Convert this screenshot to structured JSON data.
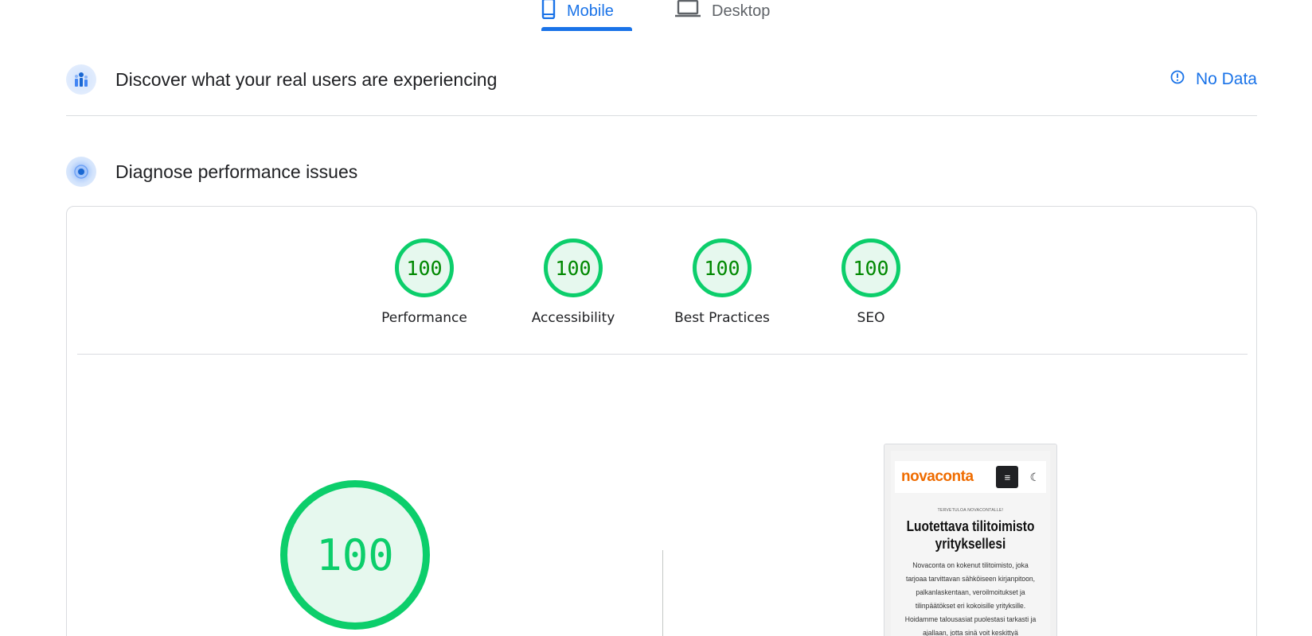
{
  "tabs": [
    {
      "label": "Mobile",
      "active": true,
      "icon": "smartphone-icon"
    },
    {
      "label": "Desktop",
      "active": false,
      "icon": "laptop-icon"
    }
  ],
  "field_data": {
    "title": "Discover what your real users are experiencing",
    "status": "No Data",
    "icon": "users-chart-icon",
    "status_icon": "info-circle-icon"
  },
  "lab_data": {
    "title": "Diagnose performance issues",
    "icon": "radar-icon"
  },
  "categories": [
    {
      "label": "Performance",
      "score": "100"
    },
    {
      "label": "Accessibility",
      "score": "100"
    },
    {
      "label": "Best Practices",
      "score": "100"
    },
    {
      "label": "SEO",
      "score": "100"
    }
  ],
  "performance": {
    "score": "100"
  },
  "screenshot": {
    "logo": "novaconta",
    "kicker": "TERVETULOA NOVACONTALLE!",
    "title": "Luotettava tilitoimisto yrityksellesi",
    "body": "Novaconta on kokenut tilitoimisto, joka tarjoaa tarvittavan sähköiseen kirjanpitoon, palkanlaskentaan, veroilmoitukset ja tilinpäätökset eri kokoisille yrityksille. Hoidamme talousasiat puolestasi tarkasti ja ajallaan, jotta sinä voit keskittyä liiketoimintaan."
  },
  "colors": {
    "accent": "#1a73e8",
    "pass_green": "#0cce6b",
    "pass_text": "#008800",
    "pass_fill": "#e6f8ee",
    "brand_orange": "#ef6c00"
  }
}
